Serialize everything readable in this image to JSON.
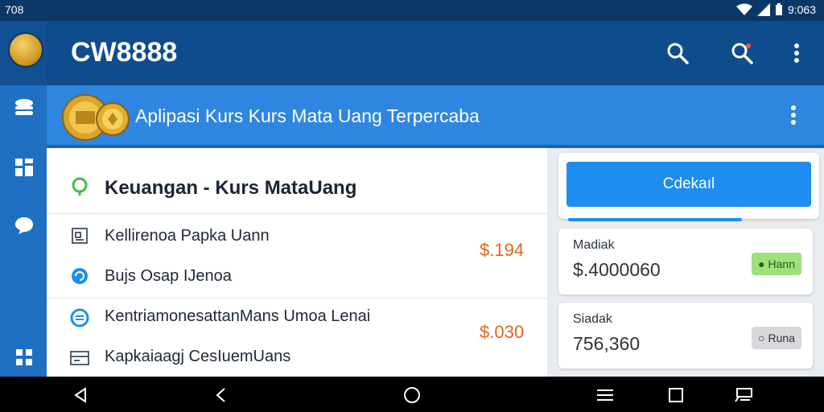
{
  "status_bar": {
    "left_text": "708",
    "time": "9:063"
  },
  "app_bar": {
    "logo": "CW8888"
  },
  "banner": {
    "title": "Aplipasi Kurs Kurs Mata Uang Terpercaba"
  },
  "main": {
    "heading": "Keuangan - Kurs MataUang",
    "rows": [
      {
        "label": "Kellirenoa Papka Uann",
        "amount": "$.194",
        "icon": "receipt-icon"
      },
      {
        "label": "Bujs Osap IJenoa",
        "icon": "chat-refresh-icon"
      },
      {
        "label": "KentriamonesattanMans Umoa Lenai",
        "amount": "$.030",
        "icon": "currency-circle-icon"
      },
      {
        "label": "Kapkaiaagj CesIuemUans",
        "icon": "card-icon"
      }
    ]
  },
  "side": {
    "button_label": "Cdekaıl",
    "progress_fraction": 0.71,
    "cards": [
      {
        "label": "Madiak",
        "value": "$.4000060",
        "chip": "Hann",
        "status": "positive"
      },
      {
        "label": "Siadak",
        "value": "756,360",
        "chip": "Runa",
        "status": "neutral"
      }
    ]
  },
  "colors": {
    "accent": "#1d8ef0",
    "positive_chip": "#9ee07c",
    "neutral_chip": "#d6d8db",
    "amount_orange": "#e0661f",
    "amount_green": "#3caa3c"
  }
}
